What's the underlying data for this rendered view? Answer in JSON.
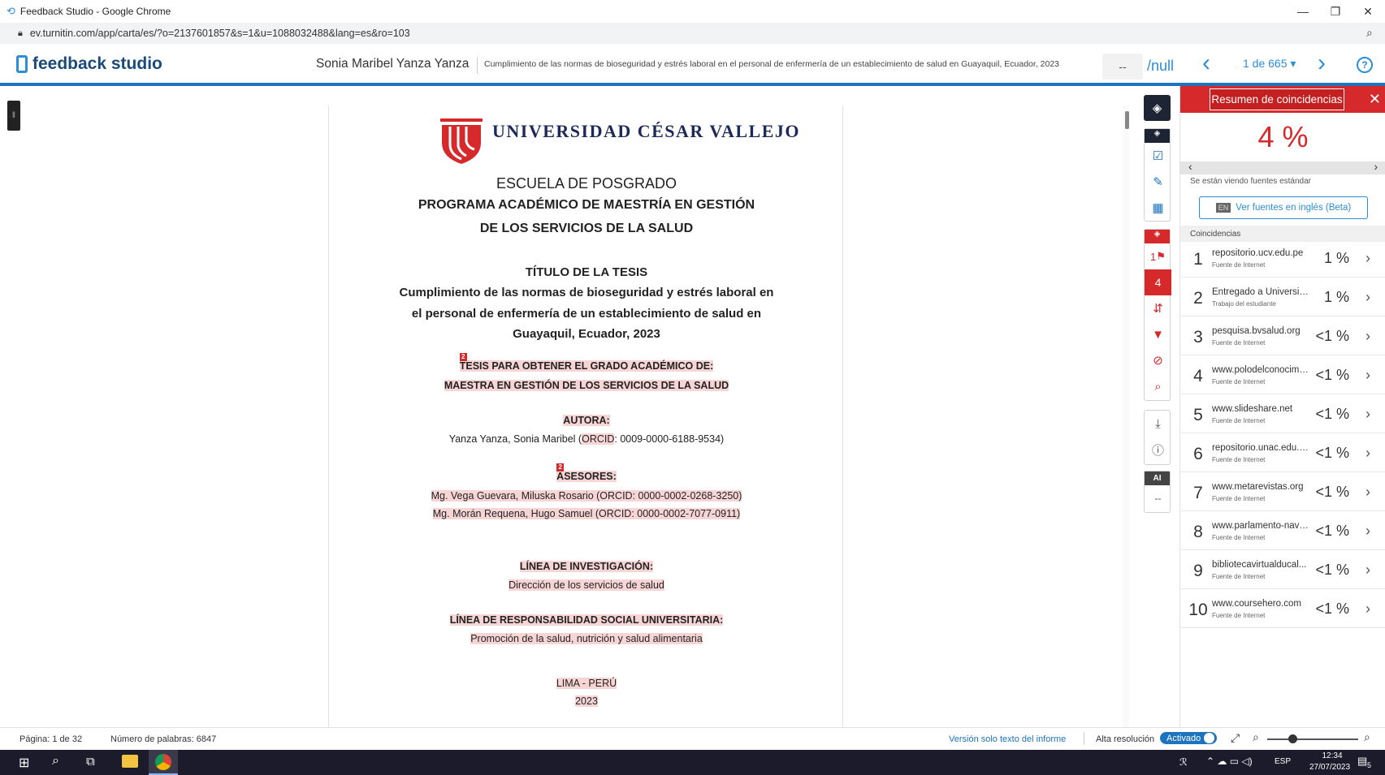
{
  "browser": {
    "window_title": "Feedback Studio - Google Chrome",
    "url": "ev.turnitin.com/app/carta/es/?o=2137601857&s=1&u=1088032488&lang=es&ro=103"
  },
  "header": {
    "logo_text": "feedback studio",
    "student_name": "Sonia Maribel Yanza Yanza",
    "paper_title": "Cumplimiento de las normas de bioseguridad y estrés laboral en el personal de enfermería de un establecimiento de salud en Guayaquil, Ecuador, 2023",
    "grade_value": "--",
    "grade_total": "/null",
    "pager": "1 de 665 ▾"
  },
  "document": {
    "university": "UNIVERSIDAD CÉSAR VALLEJO",
    "school": "ESCUELA DE POSGRADO",
    "program_line1": "PROGRAMA ACADÉMICO DE MAESTRÍA EN GESTIÓN",
    "program_line2": "DE LOS SERVICIOS DE LA SALUD",
    "title_heading": "TÍTULO DE LA TESIS",
    "title_line1": "Cumplimiento de las normas de bioseguridad y estrés laboral en",
    "title_line2": "el personal de enfermería de un establecimiento de salud en",
    "title_line3": "Guayaquil,  Ecuador,  2023",
    "match_marker": "2",
    "degree_line1": "TESIS PARA OBTENER EL GRADO ACADÉMICO DE:",
    "degree_line2": "MAESTRA EN GESTIÓN DE LOS SERVICIOS DE LA SALUD",
    "author_heading": "AUTORA:",
    "author_name_pre": "Yanza Yanza, Sonia Maribel  (",
    "author_orcid_label": "ORCID",
    "author_name_post": ": 0009-0000-6188-9534)",
    "advisors_heading": "ASESORES:",
    "advisor1": "Mg. Vega Guevara, Miluska Rosario (ORCID: 0000-0002-0268-3250)",
    "advisor2": "Mg. Morán Requena, Hugo Samuel (ORCID: 0000-0002-7077-0911)",
    "research_heading": "LÍNEA DE INVESTIGACIÓN:",
    "research_value": "Dirección de los servicios de salud",
    "social_heading": "LÍNEA DE RESPONSABILIDAD SOCIAL UNIVERSITARIA:",
    "social_value": "Promoción de la salud, nutrición y salud alimentaria",
    "city": "LIMA - PERÚ",
    "year": "2023"
  },
  "toolbar": {
    "match_count": "4",
    "flag_count": "1",
    "ai_label": "AI",
    "ai_value": "--"
  },
  "panel": {
    "title": "Resumen de coincidencias",
    "overall_pct": "4 %",
    "standard_sources_note": "Se están viendo fuentes estándar",
    "english_badge": "EN",
    "english_button": "Ver fuentes en inglés (Beta)",
    "matches_header": "Coincidencias",
    "matches": [
      {
        "num": "1",
        "source": "repositorio.ucv.edu.pe",
        "type": "Fuente de Internet",
        "pct": "1 %"
      },
      {
        "num": "2",
        "source": "Entregado a Universida...",
        "type": "Trabajo del estudiante",
        "pct": "1 %"
      },
      {
        "num": "3",
        "source": "pesquisa.bvsalud.org",
        "type": "Fuente de Internet",
        "pct": "<1 %"
      },
      {
        "num": "4",
        "source": "www.polodelconocimie...",
        "type": "Fuente de Internet",
        "pct": "<1 %"
      },
      {
        "num": "5",
        "source": "www.slideshare.net",
        "type": "Fuente de Internet",
        "pct": "<1 %"
      },
      {
        "num": "6",
        "source": "repositorio.unac.edu.pe",
        "type": "Fuente de Internet",
        "pct": "<1 %"
      },
      {
        "num": "7",
        "source": "www.metarevistas.org",
        "type": "Fuente de Internet",
        "pct": "<1 %"
      },
      {
        "num": "8",
        "source": "www.parlamento-navar...",
        "type": "Fuente de Internet",
        "pct": "<1 %"
      },
      {
        "num": "9",
        "source": "bibliotecavirtualducal...",
        "type": "Fuente de Internet",
        "pct": "<1 %"
      },
      {
        "num": "10",
        "source": "www.coursehero.com",
        "type": "Fuente de Internet",
        "pct": "<1 %"
      }
    ]
  },
  "statusbar": {
    "page": "Página: 1 de 32",
    "words": "Número de palabras: 6847",
    "text_only": "Versión solo texto del informe",
    "high_res": "Alta resolución",
    "high_res_state": "Activado"
  },
  "taskbar": {
    "lang": "ESP",
    "time": "12:34",
    "date": "27/07/2023",
    "notif": "5"
  },
  "colors": {
    "accent": "#2d8ed6",
    "match_red": "#d5292b",
    "highlight": "#f8d5d5"
  }
}
